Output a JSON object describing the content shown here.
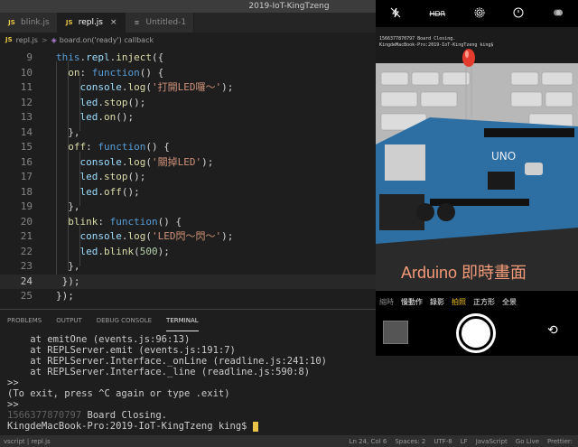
{
  "window": {
    "title": "2019-IoT-KingTzeng"
  },
  "tabs": [
    {
      "label": "blink.js",
      "icon": "JS",
      "active": false
    },
    {
      "label": "repl.js",
      "icon": "JS",
      "active": true,
      "close": "×"
    },
    {
      "label": "Untitled-1",
      "icon": "≡",
      "active": false
    }
  ],
  "breadcrumb": {
    "file": "repl.js",
    "sep": ">",
    "symbol": "board.on('ready') callback"
  },
  "editor": {
    "lines": [
      {
        "num": "9"
      },
      {
        "num": "10"
      },
      {
        "num": "11"
      },
      {
        "num": "12"
      },
      {
        "num": "13"
      },
      {
        "num": "14"
      },
      {
        "num": "15"
      },
      {
        "num": "16"
      },
      {
        "num": "17"
      },
      {
        "num": "18"
      },
      {
        "num": "19"
      },
      {
        "num": "20"
      },
      {
        "num": "21"
      },
      {
        "num": "22"
      },
      {
        "num": "23"
      },
      {
        "num": "24"
      },
      {
        "num": "25"
      }
    ],
    "strings": {
      "s1": "'打開LED囉～'",
      "s2": "'關掉LED'",
      "s3": "'LED閃～閃～'",
      "n1": "500"
    }
  },
  "panel": {
    "tabs": [
      "PROBLEMS",
      "OUTPUT",
      "DEBUG CONSOLE",
      "TERMINAL"
    ],
    "active_tab": "TERMINAL",
    "terminal": [
      "    at emitOne (events.js:96:13)",
      "    at REPLServer.emit (events.js:191:7)",
      "    at REPLServer.Interface._onLine (readline.js:241:10)",
      "    at REPLServer.Interface._line (readline.js:590:8)",
      ">>",
      "(To exit, press ^C again or type .exit)",
      ">>"
    ],
    "timestamp": "1566377870797",
    "closing_msg": "Board Closing.",
    "prompt": "KingdeMacBook-Pro:2019-IoT-KingTzeng king$ "
  },
  "status": {
    "left": "vscript | repl.js",
    "right": [
      "Ln 24, Col 6",
      "Spaces: 2",
      "UTF-8",
      "LF",
      "JavaScript",
      "Go Live",
      "Prettier:"
    ]
  },
  "phone": {
    "top_icons": [
      "flash-off-icon",
      "hdr-icon",
      "live-photo-icon",
      "timer-icon",
      "filter-icon"
    ],
    "hdr_label": "HDR",
    "screen_text_1": "1566377870797 Board Closing.",
    "screen_text_2": "KingdeMacBook-Pro:2019-IoT-KingTzeng king$",
    "board_label": "UNO",
    "modes": [
      "縮時",
      "慢動作",
      "錄影",
      "拍照",
      "正方形",
      "全景"
    ],
    "selected_mode": "拍照",
    "caption": "Arduino 即時畫面",
    "colors": {
      "selected": "#f5c518",
      "caption": "#f29a78"
    }
  }
}
